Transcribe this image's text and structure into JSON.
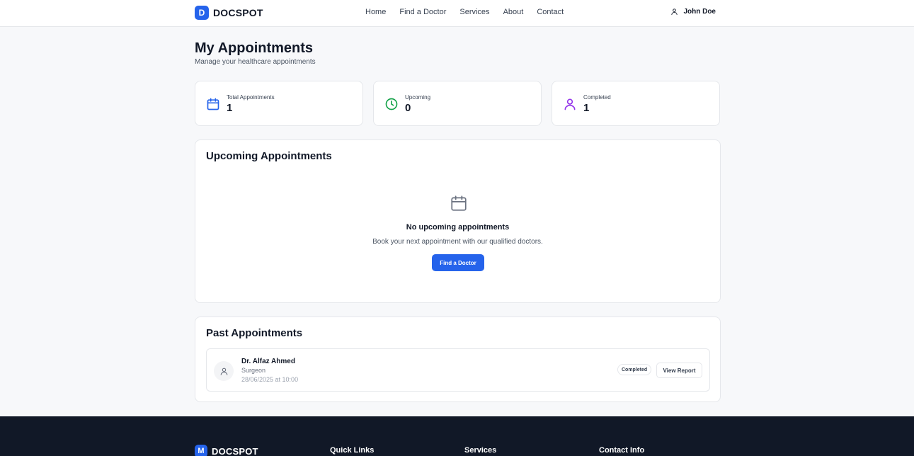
{
  "brand": {
    "mark": "D",
    "name": "DOCSPOT"
  },
  "nav": {
    "items": [
      "Home",
      "Find a Doctor",
      "Services",
      "About",
      "Contact"
    ]
  },
  "user": {
    "name": "John Doe",
    "icon": "user-icon"
  },
  "page": {
    "title": "My Appointments",
    "subtitle": "Manage your healthcare appointments"
  },
  "stats": [
    {
      "label": "Total Appointments",
      "value": "1",
      "icon": "calendar-icon",
      "color": "#2563eb"
    },
    {
      "label": "Upcoming",
      "value": "0",
      "icon": "clock-icon",
      "color": "#16a34a"
    },
    {
      "label": "Completed",
      "value": "1",
      "icon": "user-icon",
      "color": "#9333ea"
    }
  ],
  "upcoming": {
    "title": "Upcoming Appointments",
    "empty_icon": "calendar-icon",
    "empty_title": "No upcoming appointments",
    "empty_text": "Book your next appointment with our qualified doctors.",
    "button_label": "Find a Doctor"
  },
  "past": {
    "title": "Past Appointments",
    "items": [
      {
        "doctor": "Dr. Alfaz Ahmed",
        "specialty": "Surgeon",
        "datetime": "28/06/2025 at 10:00",
        "status": "Completed",
        "action": "View Report"
      }
    ]
  },
  "footer": {
    "brand_mark": "M",
    "brand_name": "DOCSPOT",
    "headings": [
      "Quick Links",
      "Services",
      "Contact Info"
    ]
  },
  "colors": {
    "primary": "#2563eb",
    "footer_bg": "#111827",
    "page_bg": "#f7f8fa"
  }
}
